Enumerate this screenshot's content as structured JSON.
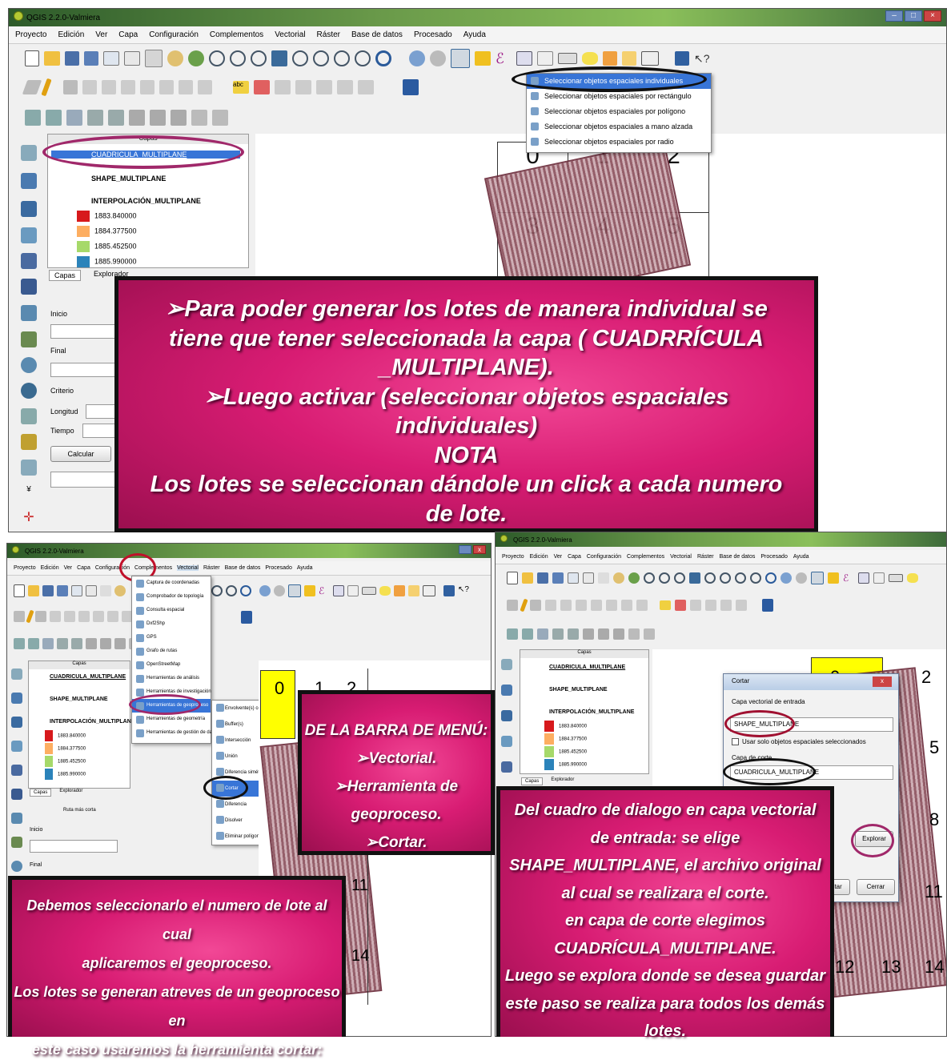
{
  "top": {
    "title": "QGIS 2.2.0-Valmiera",
    "menu": [
      "Proyecto",
      "Edición",
      "Ver",
      "Capa",
      "Configuración",
      "Complementos",
      "Vectorial",
      "Ráster",
      "Base de datos",
      "Procesado",
      "Ayuda"
    ],
    "select_menu": [
      "Seleccionar objetos espaciales individuales",
      "Seleccionar objetos espaciales por rectángulo",
      "Seleccionar objetos espaciales por polígono",
      "Seleccionar objetos espaciales a mano alzada",
      "Seleccionar objetos espaciales por radio"
    ],
    "layers_title": "Capas",
    "layers": [
      "CUADRICULA_MULTIPLANE",
      "SHAPE_MULTIPLANE",
      "INTERPOLACIÓN_MULTIPLANE"
    ],
    "legend": [
      {
        "value": "1883.840000",
        "color": "#d7191c"
      },
      {
        "value": "1884.377500",
        "color": "#fdae61"
      },
      {
        "value": "1885.452500",
        "color": "#a6d96a"
      },
      {
        "value": "1885.990000",
        "color": "#2b83ba"
      }
    ],
    "tabs": [
      "Capas",
      "Explorador"
    ],
    "form_labels": [
      "Inicio",
      "Final",
      "Criterio",
      "Longitud",
      "Tiempo"
    ],
    "calc_button": "Calcular",
    "grid_numbers": [
      "0",
      "1",
      "2",
      "3",
      "4",
      "5"
    ],
    "callout": [
      "➢Para poder generar los lotes de manera individual se",
      "tiene que  tener seleccionada la capa ( CUADRRÍCULA",
      "_MULTIPLANE).",
      "➢Luego activar (seleccionar objetos espaciales",
      "individuales)",
      "NOTA",
      "Los lotes se seleccionan dándole un click a cada numero",
      "de lote."
    ]
  },
  "left": {
    "title": "QGIS 2.2.0-Valmiera",
    "menu": [
      "Proyecto",
      "Edición",
      "Ver",
      "Capa",
      "Configuración",
      "Complementos",
      "Vectorial",
      "Ráster",
      "Base de datos",
      "Procesado",
      "Ayuda"
    ],
    "vector_menu": [
      "Captura de coordenadas",
      "Comprobador de topología",
      "Consulta espacial",
      "Dxf2Shp",
      "GPS",
      "Grafo de rutas",
      "OpenStreetMap",
      "Herramientas de análisis",
      "Herramientas de investigación",
      "Herramientas de geoproceso",
      "Herramientas de geometría",
      "Herramientas de gestión de datos"
    ],
    "geo_menu": [
      "Envolvente(s) convexa(s)",
      "Buffer(s)",
      "Intersección",
      "Unión",
      "Diferencia simétrica",
      "Cortar",
      "Diferencia",
      "Disolver",
      "Eliminar polígonos astilla"
    ],
    "layers_title": "Capas",
    "layers": [
      "CUADRICULA_MULTIPLANE",
      "SHAPE_MULTIPLANE",
      "INTERPOLACIÓN_MULTIPLANE"
    ],
    "legend": [
      "1883.840000",
      "1884.377500",
      "1885.452500",
      "1885.990000"
    ],
    "tabs": [
      "Capas",
      "Explorador"
    ],
    "route_title": "Ruta más corta",
    "form_labels": [
      "Inicio",
      "Final"
    ],
    "grid_numbers": [
      "0",
      "1",
      "2",
      "11",
      "14"
    ],
    "callout_menu": [
      "DE LA BARRA DE MENÚ:",
      "➢Vectorial.",
      "➢Herramienta de geoproceso.",
      "➢Cortar."
    ],
    "callout_bottom": [
      "Debemos  seleccionarlo el numero de lote  al cual",
      "aplicaremos el geoproceso.",
      "Los lotes se generan atreves de un geoproceso en",
      "este caso usaremos la herramienta cortar:"
    ]
  },
  "right": {
    "title": "QGIS 2.2.0-Valmiera",
    "menu": [
      "Proyecto",
      "Edición",
      "Ver",
      "Capa",
      "Configuración",
      "Complementos",
      "Vectorial",
      "Ráster",
      "Base de datos",
      "Procesado",
      "Ayuda"
    ],
    "layers_title": "Capas",
    "layers": [
      "CUADRICULA_MULTIPLANE",
      "SHAPE_MULTIPLANE",
      "INTERPOLACIÓN_MULTIPLANE"
    ],
    "legend": [
      "1883.840000",
      "1884.377500",
      "1885.452500",
      "1885.990000"
    ],
    "tabs": [
      "Capas",
      "Explorador"
    ],
    "dialog": {
      "title": "Cortar",
      "input_label": "Capa vectorial de entrada",
      "input_value": "SHAPE_MULTIPLANE",
      "checkbox": "Usar solo objetos espaciales seleccionados",
      "clip_label": "Capa de corte",
      "clip_value": "CUADRICULA_MULTIPLANE",
      "browse": "Explorar",
      "accept": "Aceptar",
      "close": "Cerrar"
    },
    "grid_numbers": [
      "0",
      "2",
      "5",
      "8",
      "11",
      "12",
      "13",
      "14"
    ],
    "callout": [
      "Del cuadro de dialogo en capa vectorial",
      "de entrada: se elige",
      "SHAPE_MULTIPLANE, el archivo original",
      "al cual se realizara el corte.",
      "en capa de corte elegimos",
      "CUADRÍCULA_MULTIPLANE.",
      "Luego se explora donde se desea guardar",
      "este paso se realiza para todos los demás",
      "lotes."
    ]
  }
}
